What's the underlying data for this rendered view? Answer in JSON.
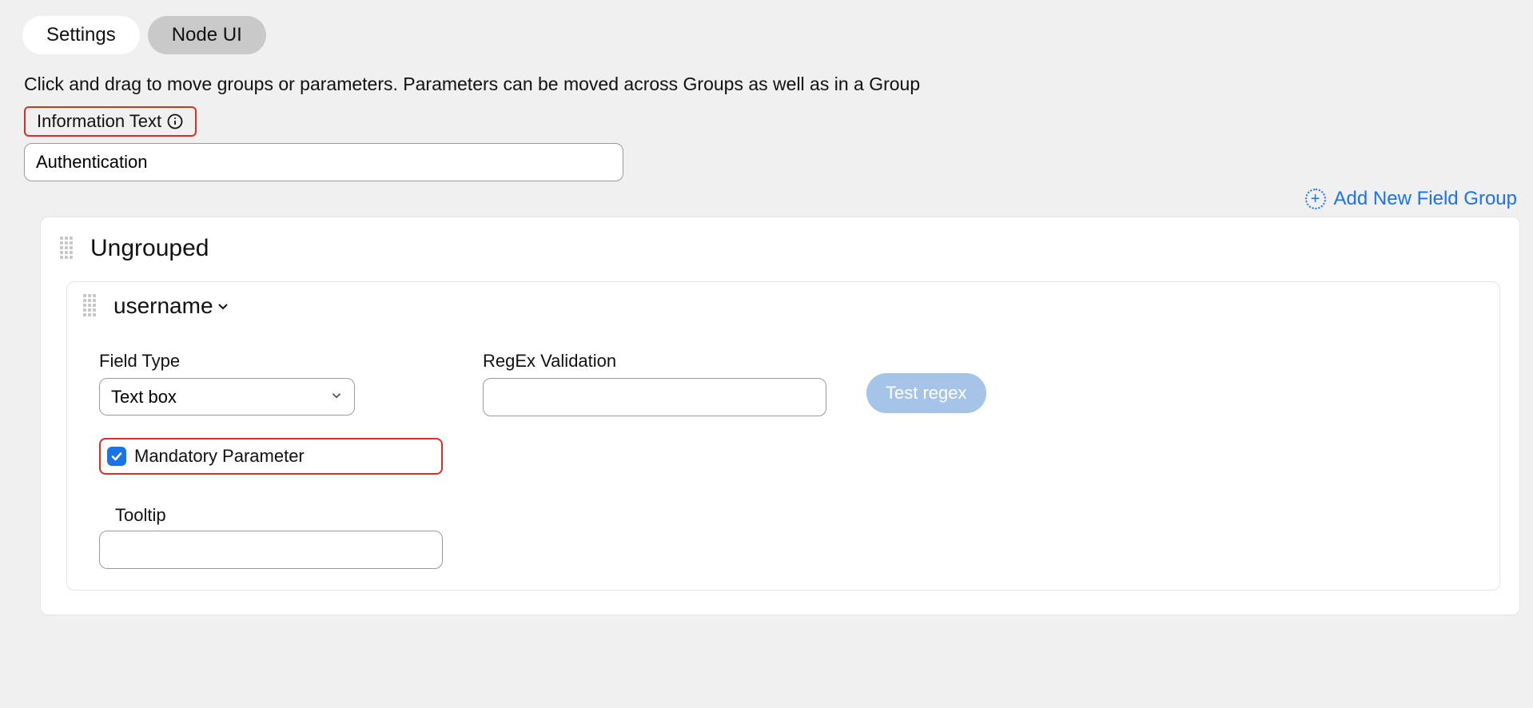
{
  "tabs": {
    "settings": "Settings",
    "node_ui": "Node UI",
    "active": "settings"
  },
  "instruction": "Click and drag to move groups or parameters. Parameters can be moved across Groups as well as in a Group",
  "info_text": {
    "label": "Information Text",
    "value": "Authentication"
  },
  "add_group_label": "Add New Field Group",
  "group": {
    "title": "Ungrouped"
  },
  "param": {
    "title": "username",
    "field_type_label": "Field Type",
    "field_type_value": "Text box",
    "field_type_options": [
      "Text box"
    ],
    "regex_label": "RegEx Validation",
    "regex_value": "",
    "test_regex_label": "Test regex",
    "mandatory_label": "Mandatory Parameter",
    "mandatory_checked": true,
    "tooltip_label": "Tooltip",
    "tooltip_value": ""
  }
}
